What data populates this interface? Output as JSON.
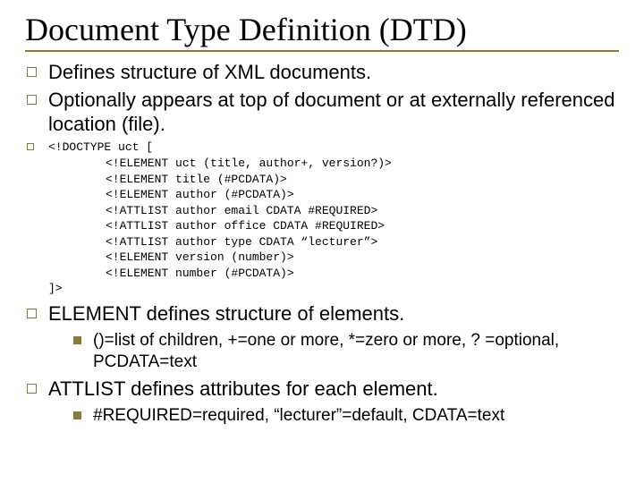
{
  "title": "Document Type Definition (DTD)",
  "bullets": {
    "b1": "Defines structure of XML documents.",
    "b2": "Optionally appears at top of document or at externally referenced location (file).",
    "code_open": "<!DOCTYPE uct [",
    "code_l1": "<!ELEMENT uct (title, author+, version?)>",
    "code_l2": "<!ELEMENT title (#PCDATA)>",
    "code_l3": "<!ELEMENT author (#PCDATA)>",
    "code_l4": "<!ATTLIST author email CDATA #REQUIRED>",
    "code_l5": "<!ATTLIST author office CDATA #REQUIRED>",
    "code_l6": "<!ATTLIST author type CDATA “lecturer”>",
    "code_l7": "<!ELEMENT version (number)>",
    "code_l8": "<!ELEMENT number (#PCDATA)>",
    "code_close": "]>",
    "b4": "ELEMENT defines structure of elements.",
    "b4_sub": "()=list of children, +=one or more, *=zero or more, ? =optional, PCDATA=text",
    "b5": "ATTLIST defines attributes for each element.",
    "b5_sub": "#REQUIRED=required, “lecturer”=default, CDATA=text"
  }
}
